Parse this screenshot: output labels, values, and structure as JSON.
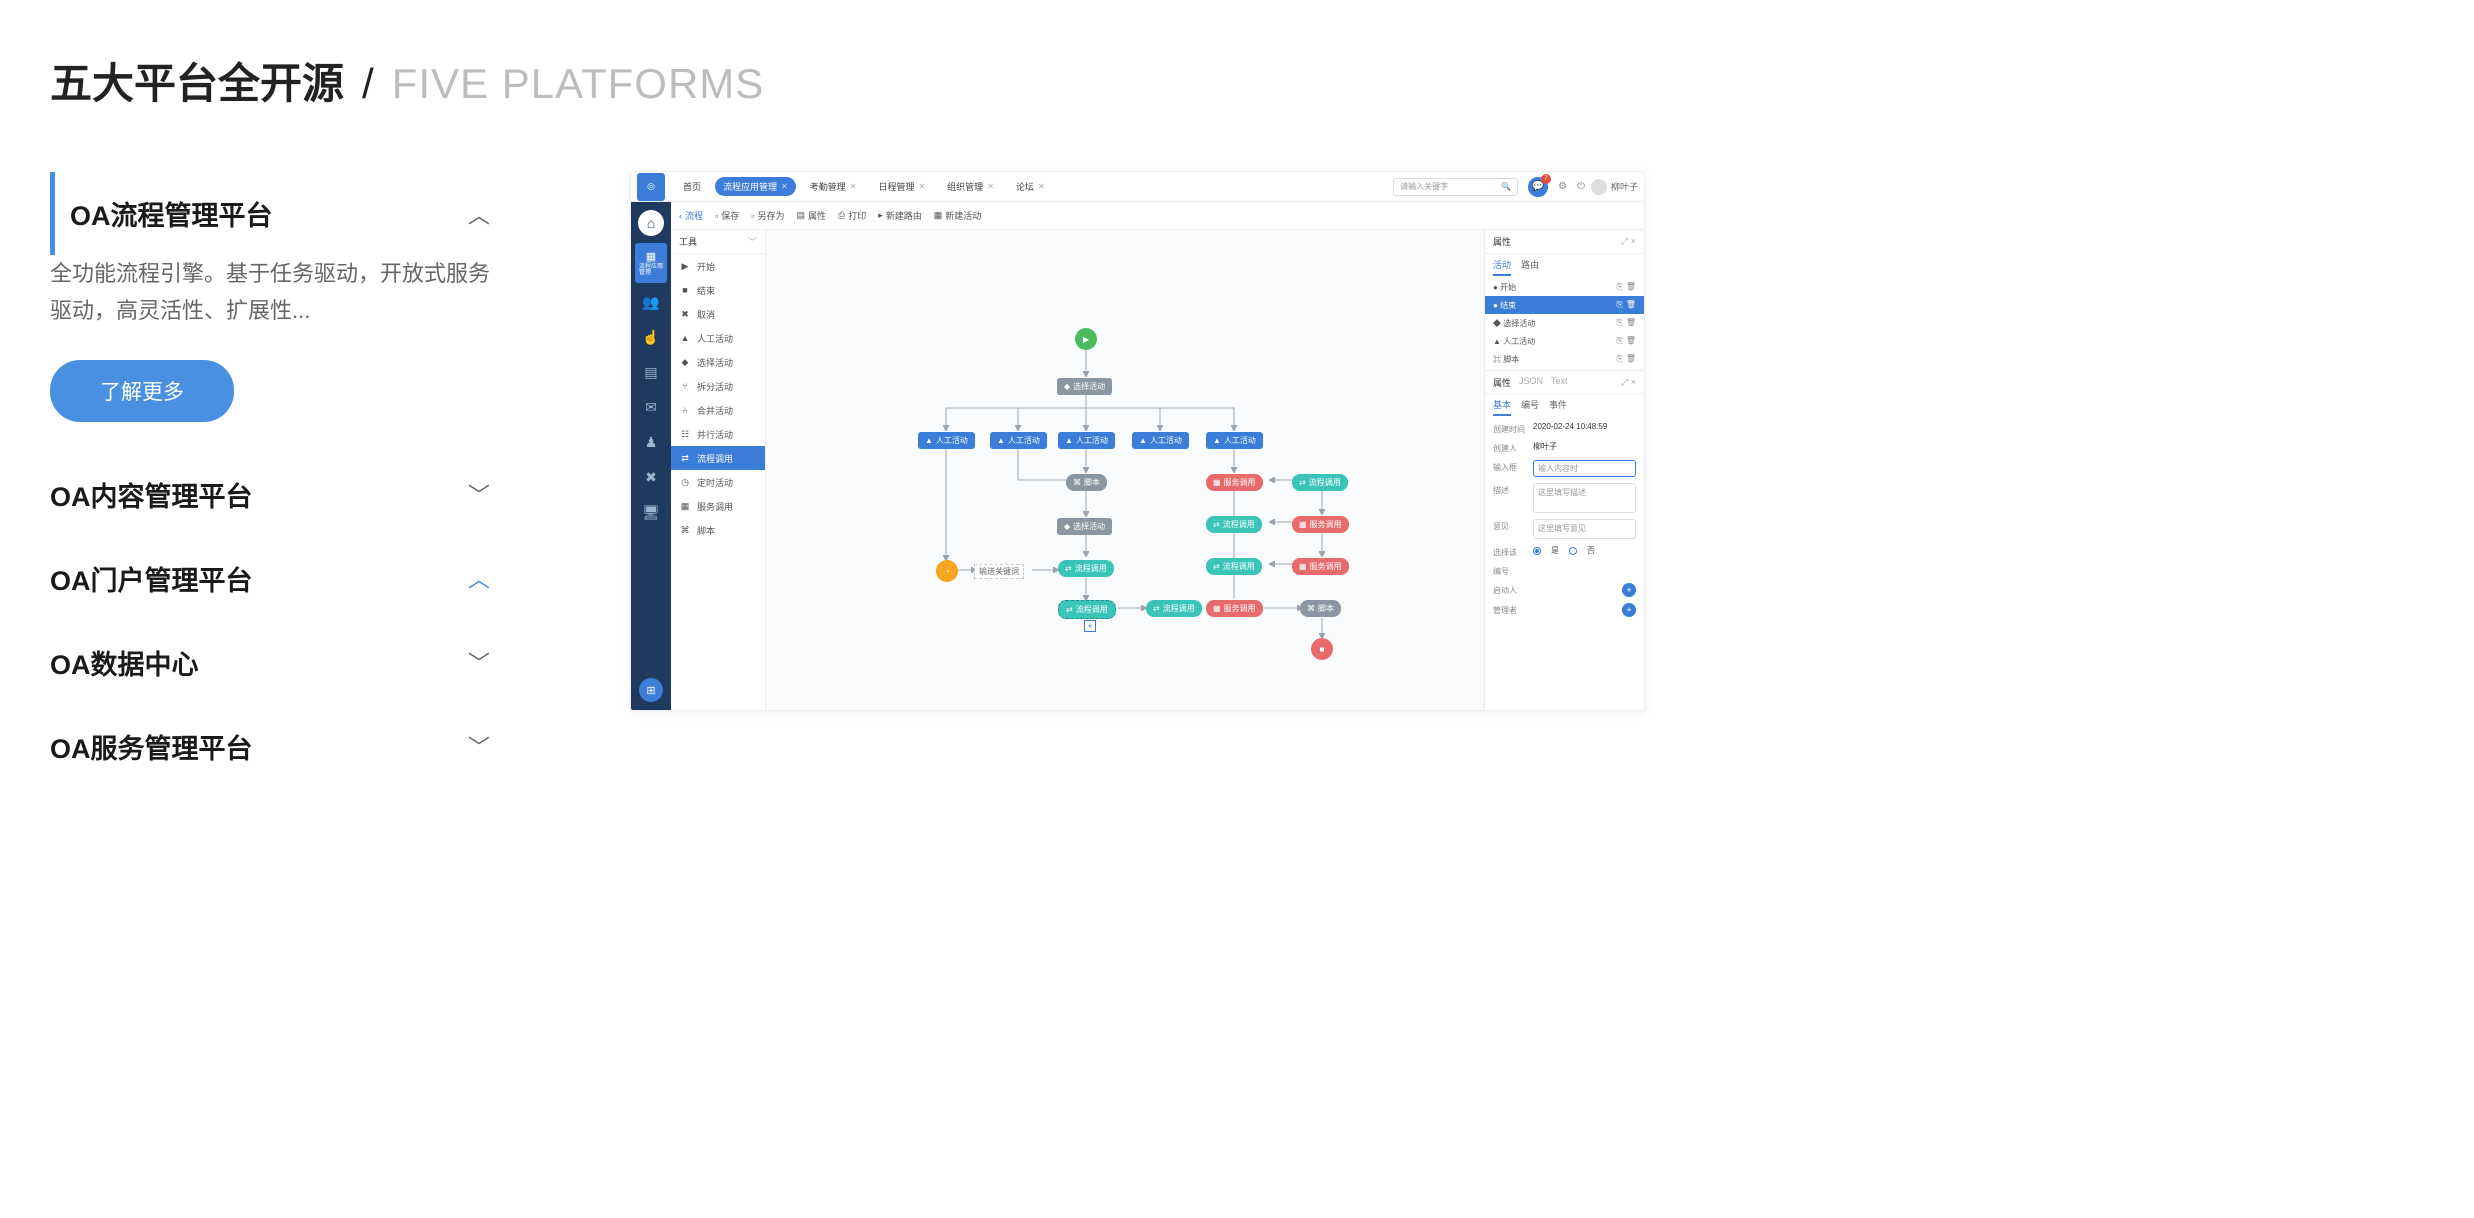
{
  "header": {
    "zh": "五大平台全开源",
    "slash": "/",
    "en": "FIVE PLATFORMS"
  },
  "accordion": [
    {
      "title": "OA流程管理平台",
      "expanded": true,
      "active_chevron": true,
      "desc": "全功能流程引擎。基于任务驱动，开放式服务驱动，高灵活性、扩展性...",
      "btn": "了解更多"
    },
    {
      "title": "OA内容管理平台",
      "expanded": false
    },
    {
      "title": "OA门户管理平台",
      "expanded": false,
      "hl_chevron": true
    },
    {
      "title": "OA数据中心",
      "expanded": false
    },
    {
      "title": "OA服务管理平台",
      "expanded": false
    }
  ],
  "topbar": {
    "tabs": [
      {
        "label": "首页",
        "close": false
      },
      {
        "label": "流程应用管理",
        "active": true,
        "close": true
      },
      {
        "label": "考勤管理",
        "close": true
      },
      {
        "label": "日程管理",
        "close": true
      },
      {
        "label": "组织管理",
        "close": true
      },
      {
        "label": "论坛",
        "close": true
      }
    ],
    "search_placeholder": "请输入关键字",
    "badge": "7",
    "user": "柳叶子"
  },
  "toolbar": {
    "back": "流程",
    "items": [
      "保存",
      "另存为",
      "属性",
      "打印",
      "新建路由",
      "新建活动"
    ]
  },
  "palette": {
    "title": "工具",
    "items": [
      "开始",
      "结束",
      "取消",
      "人工活动",
      "选择活动",
      "拆分活动",
      "合并活动",
      "并行活动",
      "流程调用",
      "定时活动",
      "服务调用",
      "脚本"
    ],
    "selected": "流程调用"
  },
  "flow": {
    "start": "▶",
    "end": "■",
    "wait": "⏰",
    "choose": "选择活动",
    "split": "拆分活动",
    "merge": "合并活动",
    "human": "人工活动",
    "script": "脚本",
    "proc": "流程调用",
    "svc": "服务调用",
    "keyword_label": "输送关键词"
  },
  "right": {
    "title": "属性",
    "close": "×",
    "tabs": [
      "活动",
      "路由"
    ],
    "list": [
      {
        "icon": "●",
        "label": "开始"
      },
      {
        "icon": "●",
        "label": "结束",
        "sel": true
      },
      {
        "icon": "◆",
        "label": "选择活动"
      },
      {
        "icon": "▲",
        "label": "人工活动"
      },
      {
        "icon": "⌘",
        "label": "脚本"
      }
    ],
    "panel2": {
      "tabs": [
        "属性",
        "JSON",
        "Text"
      ]
    },
    "subtabs": [
      "基本",
      "编号",
      "事件"
    ],
    "form": {
      "created_label": "创建时间",
      "created": "2020-02-24 10:48:59",
      "creator_label": "创建人",
      "creator": "柳叶子",
      "input_label": "输入框",
      "input_ph": "输入内容时",
      "desc_label": "描述",
      "desc_ph": "这里填写描述",
      "opinion_label": "意见",
      "opinion_ph": "这里填写意见",
      "select_label": "选择该",
      "yes": "是",
      "no": "否",
      "number_label": "编号",
      "starter_label": "启动人",
      "admin_label": "管理者"
    }
  }
}
